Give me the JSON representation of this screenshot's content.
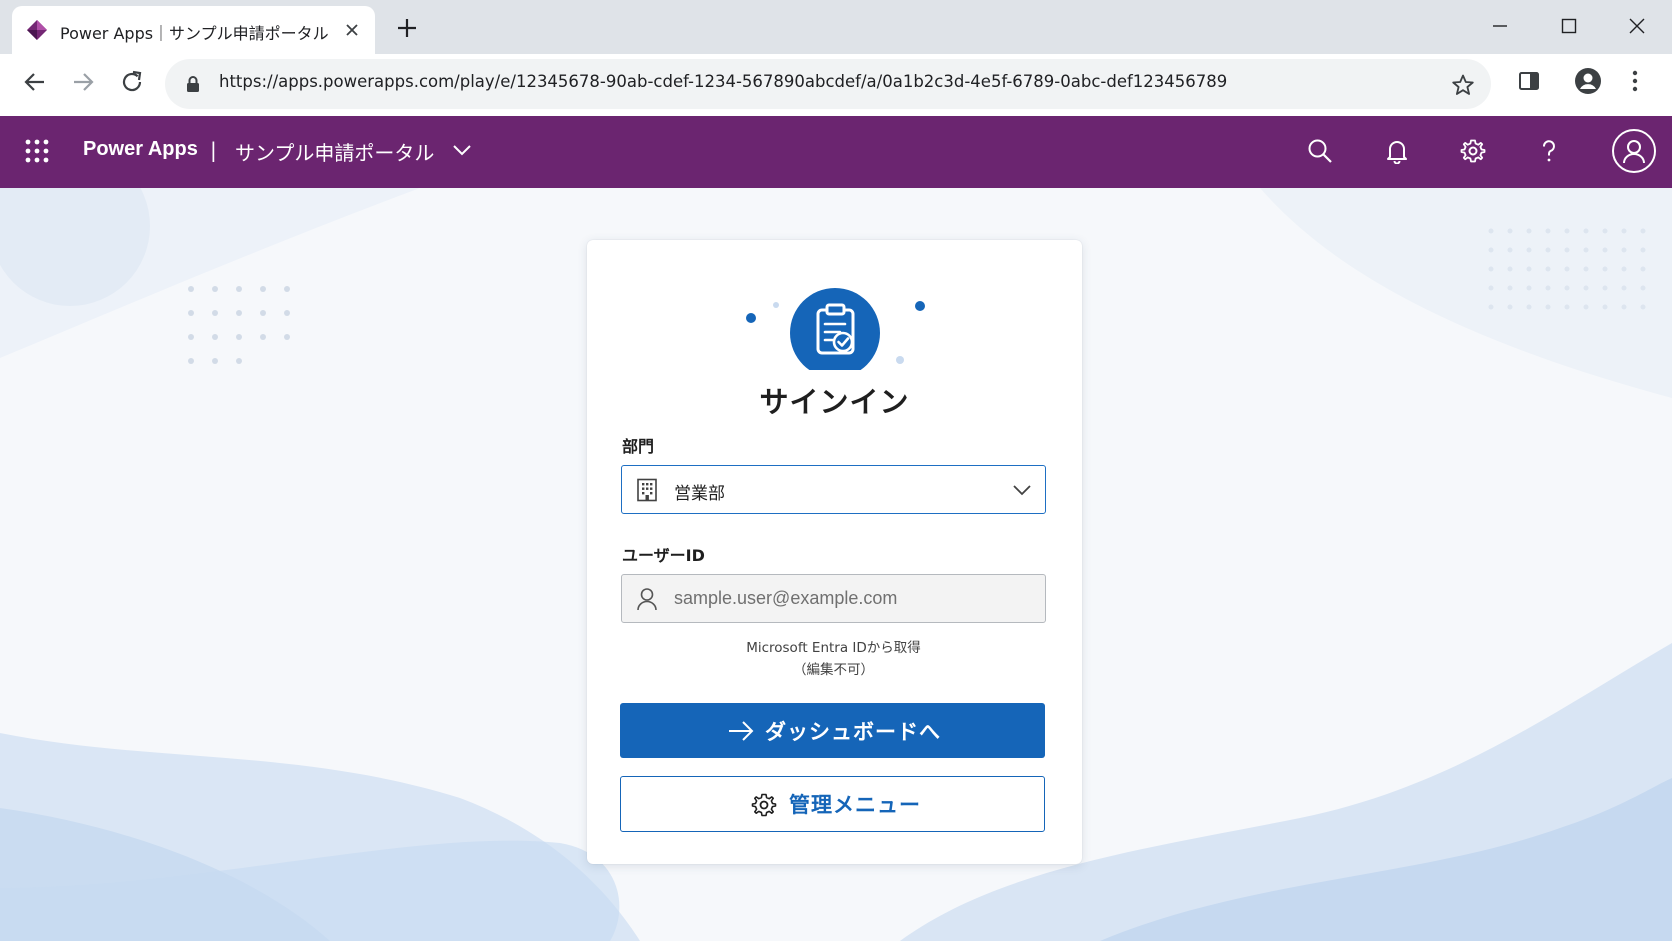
{
  "browser": {
    "tab_title": "Power Apps｜サンプル申請ポータル",
    "url": "https://apps.powerapps.com/play/e/12345678-90ab-cdef-1234-567890abcdef/a/0a1b2c3d-4e5f-6789-0abc-def123456789"
  },
  "header": {
    "app_name": "Power Apps",
    "separator": "|",
    "portal_name": "サンプル申請ポータル",
    "icons": [
      "search-icon",
      "bell-icon",
      "gear-icon",
      "help-icon",
      "account-icon"
    ]
  },
  "signin": {
    "heading": "サインイン",
    "department": {
      "label": "部門",
      "value": "営業部"
    },
    "user_id": {
      "label": "ユーザーID",
      "placeholder": "sample.user@example.com",
      "note_line1": "Microsoft Entra IDから取得",
      "note_line2": "（編集不可）"
    },
    "primary_button": "ダッシュボードへ",
    "secondary_button": "管理メニュー"
  },
  "colors": {
    "app_header": "#6b2570",
    "primary": "#1565b8",
    "background": "#f6f8fb"
  }
}
